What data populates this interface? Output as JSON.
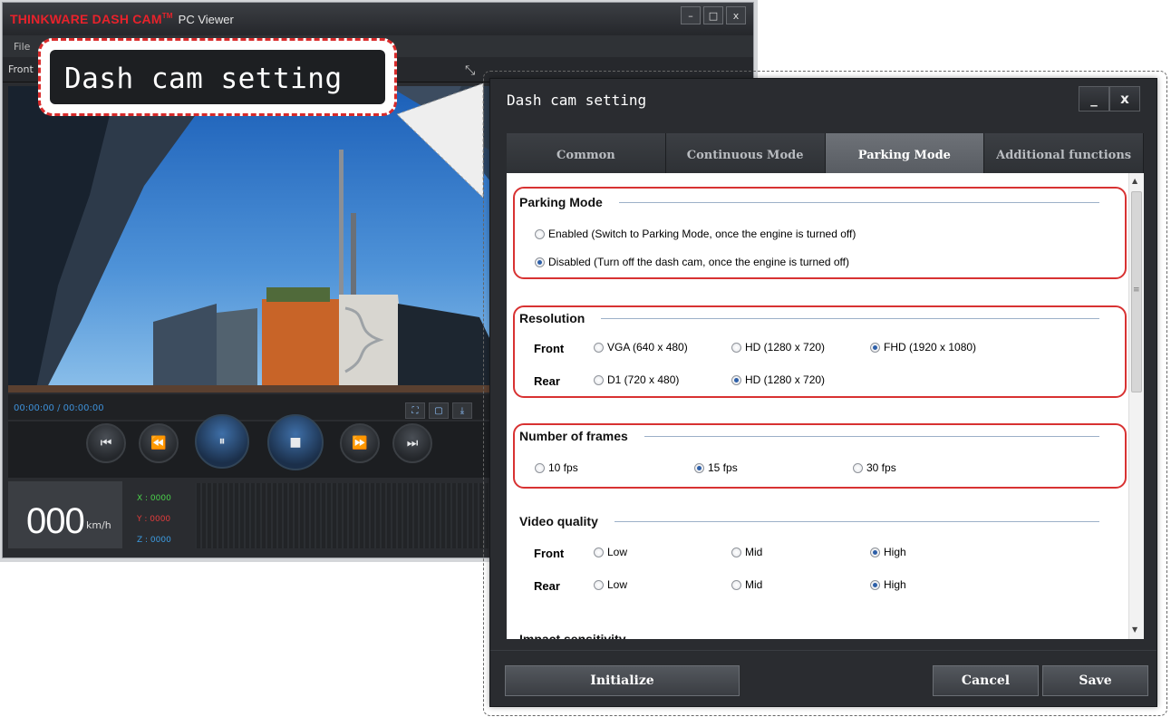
{
  "viewer": {
    "brand": "THINKWARE DASH CAM",
    "brand_tm": "TM",
    "app_name": "PC Viewer",
    "window_buttons": [
      "–",
      "□",
      "x"
    ],
    "menu_file": "File",
    "camera_label": "Front",
    "time": "00:00:00 / 00:00:00",
    "speed": "000",
    "speed_unit": "km/h",
    "coords": {
      "x": "X : 0000",
      "y": "Y : 0000",
      "z": "Z : 0000"
    }
  },
  "callout": {
    "label": "Dash cam setting"
  },
  "dialog": {
    "title": "Dash cam setting",
    "min_label": "_",
    "close_label": "x",
    "tabs": [
      "Common",
      "Continuous Mode",
      "Parking Mode",
      "Additional functions"
    ],
    "active_tab": "Parking Mode",
    "parking_mode": {
      "heading": "Parking Mode",
      "enabled": "Enabled (Switch to Parking Mode, once the engine is turned off)",
      "disabled": "Disabled  (Turn off the dash cam, once the engine is turned off)",
      "selected": "disabled"
    },
    "resolution": {
      "heading": "Resolution",
      "front_label": "Front",
      "rear_label": "Rear",
      "front_options": [
        "VGA (640 x 480)",
        "HD (1280 x 720)",
        "FHD (1920 x 1080)"
      ],
      "front_selected": 2,
      "rear_options": [
        "D1 (720 x 480)",
        "HD (1280 x 720)"
      ],
      "rear_selected": 1
    },
    "frames": {
      "heading": "Number of frames",
      "options": [
        "10 fps",
        "15 fps",
        "30 fps"
      ],
      "selected": 1
    },
    "video_quality": {
      "heading": "Video quality",
      "front_label": "Front",
      "rear_label": "Rear",
      "options": [
        "Low",
        "Mid",
        "High"
      ],
      "front_selected": 2,
      "rear_selected": 2
    },
    "impact_heading": "Impact sensitivity",
    "buttons": {
      "initialize": "Initialize",
      "cancel": "Cancel",
      "save": "Save"
    }
  }
}
